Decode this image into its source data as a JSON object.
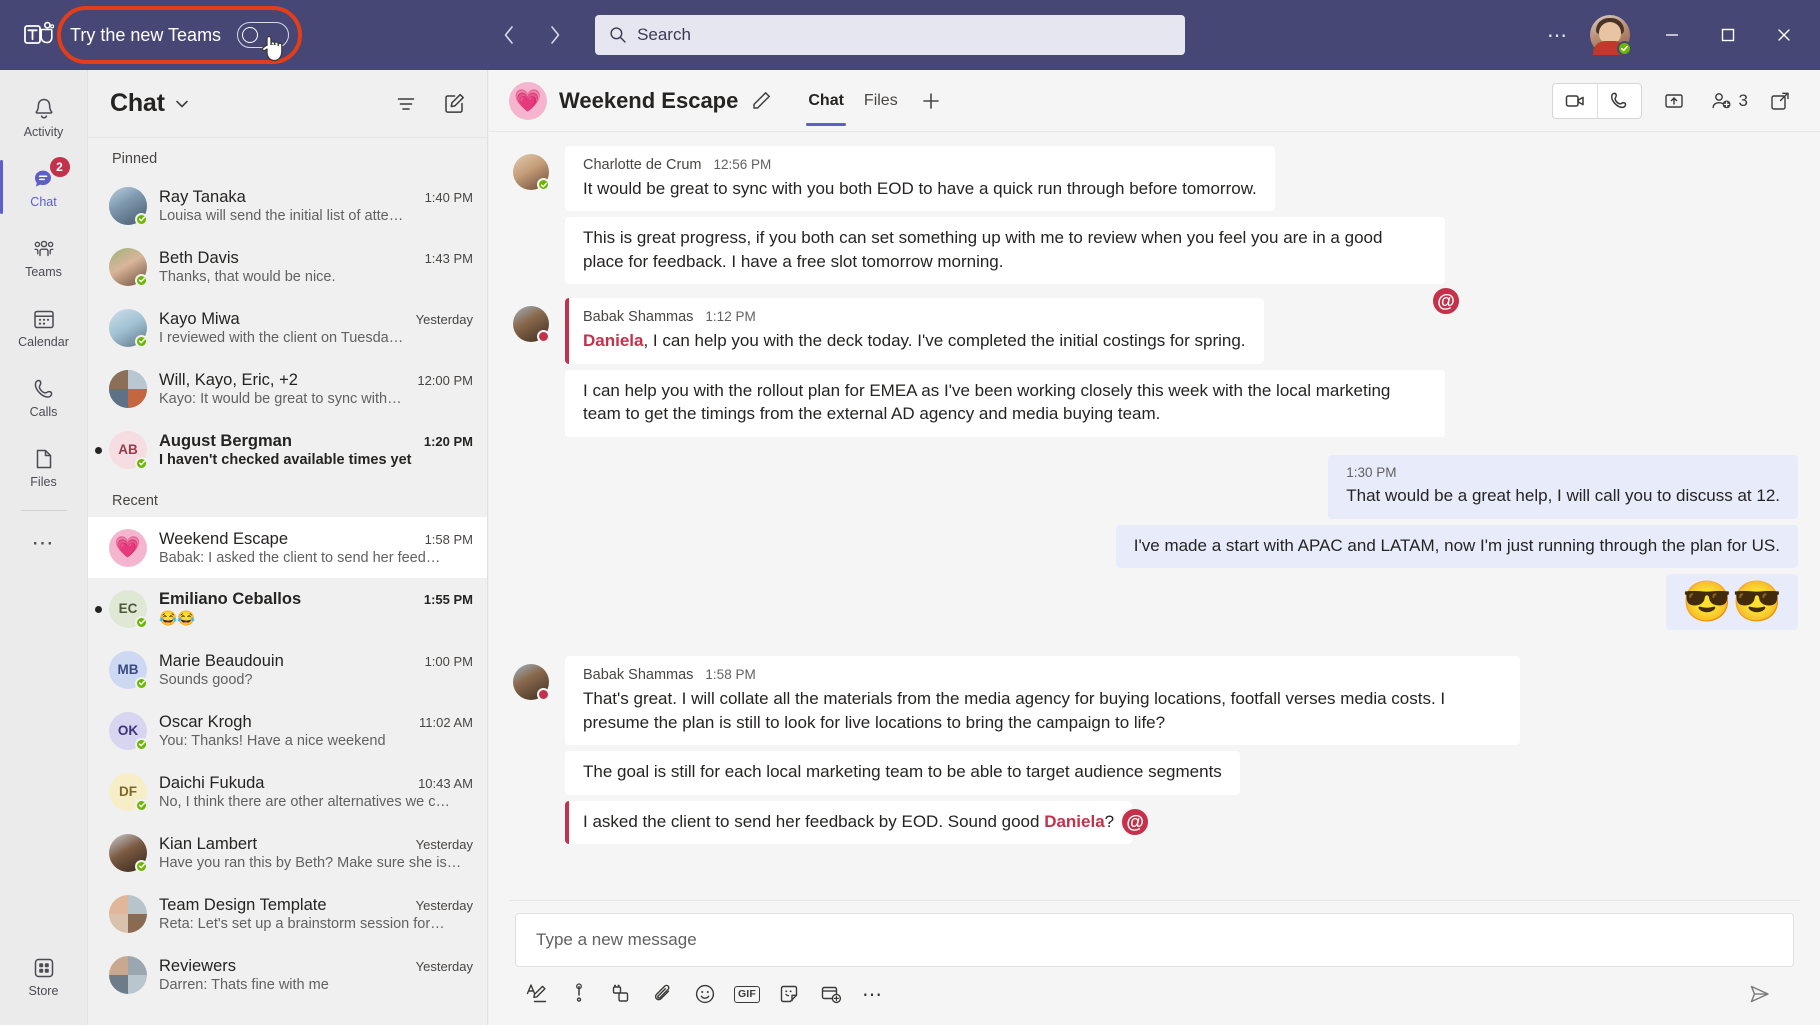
{
  "titlebar": {
    "logo_icon": "teams-logo-icon",
    "try_new_teams_label": "Try the new Teams",
    "toggle_state": "off",
    "back_icon": "chevron-left-icon",
    "forward_icon": "chevron-right-icon",
    "search_placeholder": "Search",
    "search_value": "",
    "search_icon": "search-icon",
    "more_icon": "ellipsis-icon",
    "avatar_presence": "available",
    "minimize_icon": "minimize-icon",
    "maximize_icon": "maximize-icon",
    "close_icon": "close-icon"
  },
  "rail": {
    "items": [
      {
        "label": "Activity",
        "icon": "bell-icon",
        "badge": "",
        "active": false
      },
      {
        "label": "Chat",
        "icon": "chat-bubble-icon",
        "badge": "2",
        "active": true
      },
      {
        "label": "Teams",
        "icon": "people-icon",
        "badge": "",
        "active": false
      },
      {
        "label": "Calendar",
        "icon": "calendar-icon",
        "badge": "",
        "active": false
      },
      {
        "label": "Calls",
        "icon": "phone-icon",
        "badge": "",
        "active": false
      },
      {
        "label": "Files",
        "icon": "file-icon",
        "badge": "",
        "active": false
      }
    ],
    "more_icon": "ellipsis-icon",
    "store": {
      "label": "Store",
      "icon": "store-grid-icon"
    }
  },
  "chatlist": {
    "title": "Chat",
    "title_chevron_icon": "chevron-down-icon",
    "filter_icon": "filter-icon",
    "compose_icon": "compose-new-chat-icon",
    "sections": [
      {
        "label": "Pinned",
        "rows": [
          {
            "name": "Ray Tanaka",
            "time": "1:40 PM",
            "preview": "Louisa will send the initial list of atte…",
            "avatar_type": "photo",
            "avatar_color": "#8aa6c0",
            "initials": "",
            "unread": false,
            "selected": false,
            "presence": "available"
          },
          {
            "name": "Beth Davis",
            "time": "1:43 PM",
            "preview": "Thanks, that would be nice.",
            "avatar_type": "photo",
            "avatar_color": "#7c8c5a",
            "initials": "",
            "unread": false,
            "selected": false,
            "presence": "available"
          },
          {
            "name": "Kayo Miwa",
            "time": "Yesterday",
            "preview": "I reviewed with the client on Tuesda…",
            "avatar_type": "photo",
            "avatar_color": "#a8c3d4",
            "initials": "",
            "unread": false,
            "selected": false,
            "presence": "available"
          },
          {
            "name": "Will, Kayo, Eric, +2",
            "time": "12:00 PM",
            "preview": "Kayo: It would be great to sync with…",
            "avatar_type": "group",
            "avatar_color": "#6d7a88",
            "initials": "",
            "unread": false,
            "selected": false,
            "presence": "none"
          },
          {
            "name": "August Bergman",
            "time": "1:20 PM",
            "preview": "I haven't checked available times yet",
            "avatar_type": "initials",
            "avatar_color": "#f6dde2",
            "initials": "AB",
            "unread": true,
            "selected": false,
            "presence": "available"
          }
        ]
      },
      {
        "label": "Recent",
        "rows": [
          {
            "name": "Weekend Escape",
            "time": "1:58 PM",
            "preview": "Babak: I asked the client to send her feed…",
            "avatar_type": "emoji",
            "avatar_color": "#f5b5ce",
            "initials": "💗",
            "unread": false,
            "selected": true,
            "presence": "none"
          },
          {
            "name": "Emiliano Ceballos",
            "time": "1:55 PM",
            "preview": "😂😂",
            "avatar_type": "initials",
            "avatar_color": "#dfe8d4",
            "initials": "EC",
            "unread": true,
            "selected": false,
            "presence": "available"
          },
          {
            "name": "Marie Beaudouin",
            "time": "1:00 PM",
            "preview": "Sounds good?",
            "avatar_type": "initials",
            "avatar_color": "#cdd9f2",
            "initials": "MB",
            "unread": false,
            "selected": false,
            "presence": "available"
          },
          {
            "name": "Oscar Krogh",
            "time": "11:02 AM",
            "preview": "You: Thanks! Have a nice weekend",
            "avatar_type": "initials",
            "avatar_color": "#d8d5f0",
            "initials": "OK",
            "unread": false,
            "selected": false,
            "presence": "available"
          },
          {
            "name": "Daichi Fukuda",
            "time": "10:43 AM",
            "preview": "No, I think there are other alternatives we c…",
            "avatar_type": "initials",
            "avatar_color": "#f7eec8",
            "initials": "DF",
            "unread": false,
            "selected": false,
            "presence": "available"
          },
          {
            "name": "Kian Lambert",
            "time": "Yesterday",
            "preview": "Have you ran this by Beth? Make sure she is…",
            "avatar_type": "photo",
            "avatar_color": "#5c4433",
            "initials": "",
            "unread": false,
            "selected": false,
            "presence": "available"
          },
          {
            "name": "Team Design Template",
            "time": "Yesterday",
            "preview": "Reta: Let's set up a brainstorm session for…",
            "avatar_type": "group",
            "avatar_color": "#c0a08c",
            "initials": "",
            "unread": false,
            "selected": false,
            "presence": "none"
          },
          {
            "name": "Reviewers",
            "time": "Yesterday",
            "preview": "Darren: Thats fine with me",
            "avatar_type": "group",
            "avatar_color": "#8f9aa8",
            "initials": "",
            "unread": false,
            "selected": false,
            "presence": "none"
          }
        ]
      }
    ]
  },
  "conversation": {
    "avatar_emoji": "💗",
    "title": "Weekend Escape",
    "edit_icon": "pencil-icon",
    "tabs": [
      {
        "label": "Chat",
        "active": true
      },
      {
        "label": "Files",
        "active": false
      }
    ],
    "add_tab_icon": "plus-icon",
    "video_call_icon": "video-camera-icon",
    "audio_call_icon": "phone-icon",
    "share_icon": "share-screen-icon",
    "add_people_icon": "add-person-icon",
    "participant_count": "3",
    "popout_icon": "pop-out-icon",
    "messages": [
      {
        "kind": "incoming-group",
        "author": "Charlotte de Crum",
        "time": "12:56 PM",
        "presence": "available",
        "avatar_color": "#c9a98a",
        "mention_badge": "",
        "bubbles": [
          {
            "text": "It would be great to sync with you both EOD to have a quick run through before tomorrow.",
            "mention": false,
            "show_header": true
          },
          {
            "text": "This is great progress, if you both can set something up with me to review when you feel you are in a good place for feedback. I have a free slot tomorrow morning.",
            "mention": false,
            "show_header": false
          }
        ]
      },
      {
        "kind": "incoming-group",
        "author": "Babak Shammas",
        "time": "1:12 PM",
        "presence": "busy",
        "avatar_color": "#6d563f",
        "mention_badge": "@",
        "bubbles": [
          {
            "text": ", I can help you with the deck today. I've completed the initial costings for spring.",
            "mention_prefix": "Daniela",
            "mention": true,
            "show_header": true
          },
          {
            "text": "I can help you with the rollout plan for EMEA as I've been working closely this week with the local marketing team to get the timings from the external AD agency and media buying team.",
            "mention": false,
            "show_header": false
          }
        ]
      },
      {
        "kind": "outgoing",
        "bubbles": [
          {
            "text": "That would be a great help, I will call you to discuss at 12.",
            "time": "1:30 PM",
            "type": "text"
          },
          {
            "text": "I've made a start with APAC and LATAM, now I'm just running through the plan for US.",
            "time": "",
            "type": "text"
          },
          {
            "text": "😎😎",
            "time": "",
            "type": "emoji"
          }
        ]
      },
      {
        "kind": "incoming-group",
        "author": "Babak Shammas",
        "time": "1:58 PM",
        "presence": "busy",
        "avatar_color": "#6d563f",
        "mention_badge": "",
        "bubbles": [
          {
            "text": "That's great. I will collate all the materials from the media agency for buying locations, footfall verses media costs. I presume the plan is still to look for live locations to bring the campaign to life?",
            "mention": false,
            "show_header": true
          },
          {
            "text": "The goal is still for each local marketing team to be able to target audience segments",
            "mention": false,
            "show_header": false
          },
          {
            "text": "I asked the client to send her feedback by EOD. Sound good ",
            "mention_suffix": "Daniela",
            "mention_tail": "?",
            "mention": true,
            "inline_badge": "@",
            "show_header": false
          }
        ]
      }
    ]
  },
  "composer": {
    "placeholder": "Type a new message",
    "value": "",
    "tools": [
      {
        "icon": "format-text-icon",
        "name": "format-button"
      },
      {
        "icon": "priority-icon",
        "name": "set-delivery-options-button"
      },
      {
        "icon": "loop-components-icon",
        "name": "loop-component-button"
      },
      {
        "icon": "attach-paperclip-icon",
        "name": "attach-file-button"
      },
      {
        "icon": "emoji-smiley-icon",
        "name": "emoji-button"
      },
      {
        "icon": "gif-icon",
        "name": "giphy-button",
        "text": "GIF"
      },
      {
        "icon": "sticker-icon",
        "name": "sticker-button"
      },
      {
        "icon": "meet-now-icon",
        "name": "meet-now-button"
      },
      {
        "icon": "ellipsis-icon",
        "name": "more-options-button"
      }
    ],
    "send_icon": "send-icon"
  },
  "colors": {
    "brand_purple": "#464775",
    "accent_blue_purple": "#5b5fc7",
    "mention_red": "#c4314b",
    "highlight_ring": "#e33d19",
    "presence_available": "#6bb700",
    "presence_busy": "#c4314b",
    "outgoing_bubble": "#e8ebfa",
    "incoming_bubble": "#ffffff",
    "app_bg": "#f5f5f5",
    "rail_bg": "#ebebeb",
    "chatlist_bg": "#f0f0f0"
  }
}
